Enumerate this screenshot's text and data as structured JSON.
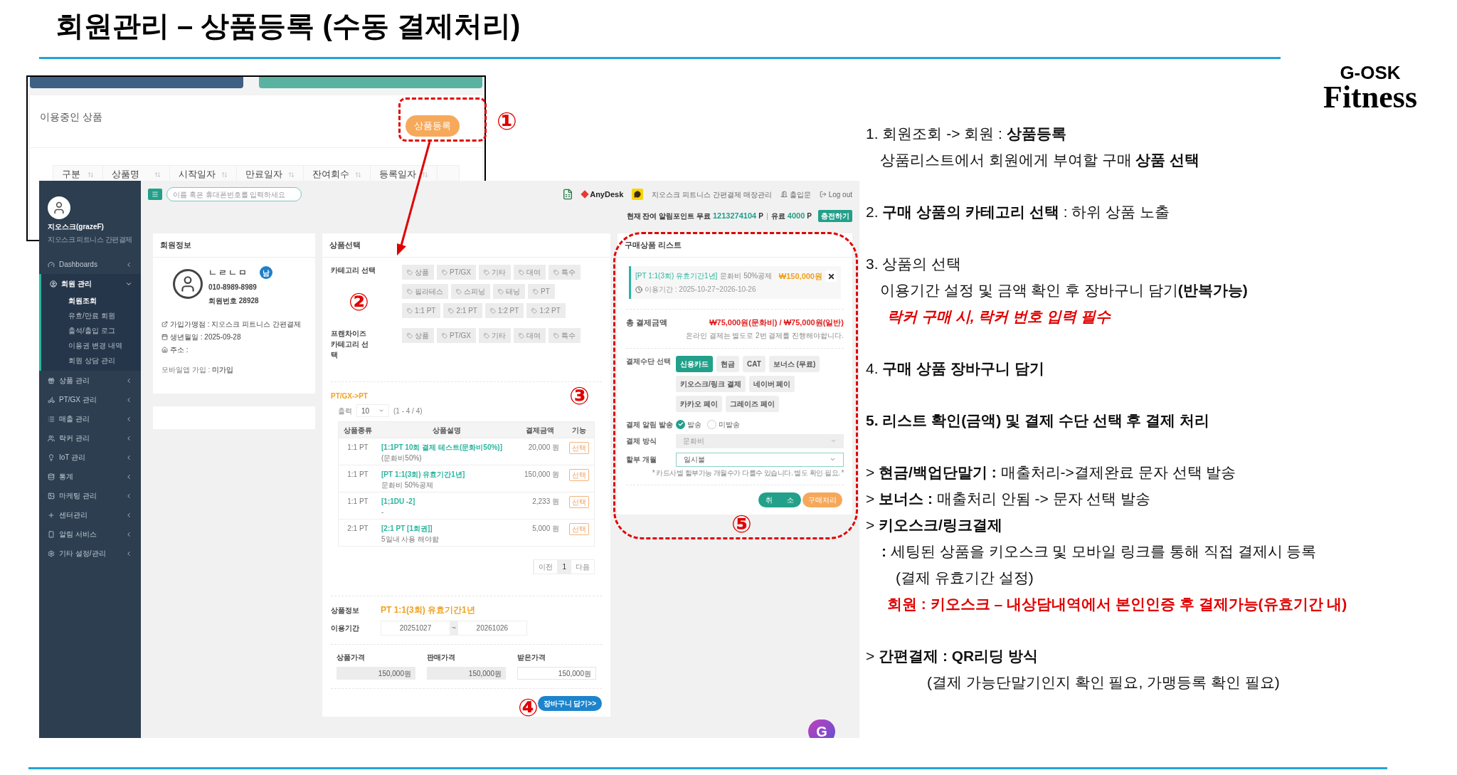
{
  "title": "회원관리 – 상품등록 (수동 결제처리)",
  "logo": {
    "brand": "G-OSK",
    "tagline": "Fitness"
  },
  "previous_screen": {
    "section_title": "이용중인 상품",
    "register_button": "상품등록",
    "columns": [
      "구분",
      "상품명",
      "시작일자",
      "만료일자",
      "잔여회수",
      "등록일자"
    ]
  },
  "sidebar": {
    "user_name": "지오스크(grazeF)",
    "user_store": "지오스크 피트니스 간편결제",
    "items": [
      {
        "label": "Dashboards",
        "expanded": false
      },
      {
        "label": "회원 관리",
        "expanded": true,
        "children": [
          {
            "label": "회원조회",
            "selected": true
          },
          {
            "label": "유효/만료 회원",
            "selected": false
          },
          {
            "label": "출석/출입 로그",
            "selected": false
          },
          {
            "label": "이용권 변경 내역",
            "selected": false
          },
          {
            "label": "회원 상담 관리",
            "selected": false
          }
        ]
      },
      {
        "label": "상품 관리",
        "expanded": false
      },
      {
        "label": "PT/GX 관리",
        "expanded": false
      },
      {
        "label": "매출 관리",
        "expanded": false
      },
      {
        "label": "락커 관리",
        "expanded": false
      },
      {
        "label": "IoT 관리",
        "expanded": false
      },
      {
        "label": "통계",
        "expanded": false
      },
      {
        "label": "마케팅 관리",
        "expanded": false
      },
      {
        "label": "센터관리",
        "expanded": false
      },
      {
        "label": "알림 서비스",
        "expanded": false
      },
      {
        "label": "기타 설정/관리",
        "expanded": false
      }
    ]
  },
  "topbar": {
    "search_placeholder": "이름 혹은 휴대폰번호를 입력하세요",
    "anydesk": "AnyDesk",
    "store_link": "지오스크 피트니스 간편결제 매장관리",
    "door": "출입문",
    "logout": "Log out",
    "points_label": "현재 잔여 알림포인트 무료",
    "free_points": "1213274104",
    "free_unit": "P",
    "paid_label": "유료",
    "paid_points": "4000",
    "paid_unit": "P",
    "charge_button": "충전하기"
  },
  "member_card": {
    "title": "회원정보",
    "name": "ㄴㄹㄴㅁ",
    "gender": "남",
    "phone": "010-8989-8989",
    "member_no": "회원번호 28928",
    "store": "가입가맹점 : 지오스크 피트니스 간편결제",
    "birthday": "생년월일 : 2025-09-28",
    "address": "주소 :",
    "app": "모바일앱 가입 : **미가입**"
  },
  "product_select": {
    "title": "상품선택",
    "category_label": "카테고리 선택",
    "category_rows": [
      [
        "상품",
        "PT/GX",
        "기타",
        "대여",
        "특수"
      ],
      [
        "필라테스",
        "스피닝",
        "태닝",
        "PT"
      ],
      [
        "1:1 PT",
        "2:1 PT",
        "1:2 PT",
        "1:2 PT"
      ]
    ],
    "franchise_label": "프랜차이즈 카테고리 선택",
    "franchise_tags": [
      "상품",
      "PT/GX",
      "기타",
      "대여",
      "특수"
    ],
    "breadcrumb": "PT/GX->PT",
    "rows_label": "출력",
    "rows_value": "10",
    "range": "(1 - 4 / 4)",
    "columns": [
      "상품종류",
      "상품설명",
      "결제금액",
      "기능"
    ],
    "rows": [
      {
        "type": "1:1 PT",
        "name": "[1:1PT 10회 결제 테스트(문화비50%)]",
        "desc": "(문화비50%)",
        "price": "20,000 원",
        "action": "선택"
      },
      {
        "type": "1:1 PT",
        "name": "[PT 1:1(3회) 유효기간1년]",
        "desc": "문화비 50%공제",
        "price": "150,000 원",
        "action": "선택"
      },
      {
        "type": "1:1 PT",
        "name": "[1;1DU -2]",
        "desc": "-",
        "price": "2,233 원",
        "action": "선택"
      },
      {
        "type": "2:1 PT",
        "name": "[2:1 PT [1회권]]",
        "desc": "5일내 사용 해야함",
        "price": "5,000 원",
        "action": "선택"
      }
    ],
    "pages": [
      {
        "label": "이전",
        "selected": false
      },
      {
        "label": "1",
        "selected": true
      },
      {
        "label": "다음",
        "selected": false
      }
    ],
    "info_label": "상품정보",
    "info_value": "PT 1:1(3회) 유효기간1년",
    "period_label": "이용기간",
    "period_start": "20251027",
    "period_sep": "~",
    "period_end": "20261026",
    "prices": [
      {
        "label": "상품가격",
        "value": "150,000원",
        "editable": false
      },
      {
        "label": "판매가격",
        "value": "150,000원",
        "editable": false
      },
      {
        "label": "받은가격",
        "value": "150,000원",
        "editable": true
      }
    ],
    "cart_button": "장바구니 담기>>"
  },
  "purchase_list": {
    "title": "구매상품 리스트",
    "item": {
      "name": "[PT 1:1(3회) 유효기간1년]",
      "desc": "문화비 50%공제",
      "price": "₩150,000원",
      "period": "이용기간 : 2025-10-27~2026-10-26"
    },
    "total_label": "총 결제금액",
    "total": "₩75,000원(문화비) / ₩75,000원(일반)",
    "total_note": "온라인 결제는 별도로 2번 결제를 진행해야합니다.",
    "method_label": "결제수단 선택",
    "methods": [
      {
        "label": "신용카드",
        "selected": true
      },
      {
        "label": "현금",
        "selected": false
      },
      {
        "label": "CAT",
        "selected": false
      },
      {
        "label": "보너스 (무료)",
        "selected": false
      },
      {
        "label": "키오스크/링크 결제",
        "selected": false
      },
      {
        "label": "네이버 페이",
        "selected": false
      },
      {
        "label": "카카오 페이",
        "selected": false
      },
      {
        "label": "그레이즈 페이",
        "selected": false
      }
    ],
    "notify_label": "결제 알림 발송",
    "notify_options": [
      {
        "label": "발송",
        "selected": true
      },
      {
        "label": "미발송",
        "selected": false
      }
    ],
    "selects": [
      {
        "label": "결제 방식",
        "value": "문화비",
        "disabled": true
      },
      {
        "label": "할부 개월",
        "value": "일시불",
        "disabled": false
      }
    ],
    "installment_hint": "* 카드사별 할부가능 개월수가 다를수 있습니다. 별도 확인 필요. *",
    "cancel_button": "취　　소",
    "purchase_button": "구매처리"
  },
  "floating_button": "G",
  "markers": [
    "①",
    "②",
    "③",
    "④",
    "⑤"
  ],
  "notes": [
    {
      "kind": "step",
      "text": "1. 회원조회 -> 회원 : **상품등록**"
    },
    {
      "kind": "sub",
      "text": "상품리스트에서 회원에게 부여할 구매 **상품 선택**"
    },
    {
      "kind": "step",
      "text": "2. **구매 상품의 카테고리 선택** : 하위 상품 노출"
    },
    {
      "kind": "step",
      "text": "3. 상품의 선택"
    },
    {
      "kind": "sub",
      "text": "이용기간 설정 및 금액 확인 후 장바구니 담기**(반복가능)**"
    },
    {
      "kind": "warning",
      "text": "*락커 구매 시, 락커 번호 입력 필수*"
    },
    {
      "kind": "step",
      "text": "4. **구매 상품 장바구니 담기**"
    },
    {
      "kind": "step",
      "text": "**5. 리스트 확인(금액) 및 결제 수단 선택 후 결제 처리**"
    },
    {
      "kind": "group",
      "text": "> **현금/백업단말기 :** 매출처리->결제완료 문자 선택 발송"
    },
    {
      "kind": "bullet",
      "text": "> **보너스 :** 매출처리 안됨 -> 문자 선택 발송"
    },
    {
      "kind": "bullet",
      "text": "> **키오스크/링크결제**"
    },
    {
      "kind": "detail",
      "text": "**:** 세팅된 상품을 키오스크 및 모바일 링크를 통해 직접 결제시 등록"
    },
    {
      "kind": "note",
      "text": "(결제 유효기간 설정)"
    },
    {
      "kind": "warning",
      "text": "회원 : 키오스크 – 내상담내역에서 본인인증 후 결제가능(유효기간 내)"
    },
    {
      "kind": "group",
      "text": "> **간편결제 : QR리딩 방식**"
    },
    {
      "kind": "footnote",
      "text": "(결제 가능단말기인지 확인 필요, 가맹등록 확인 필요)"
    }
  ]
}
